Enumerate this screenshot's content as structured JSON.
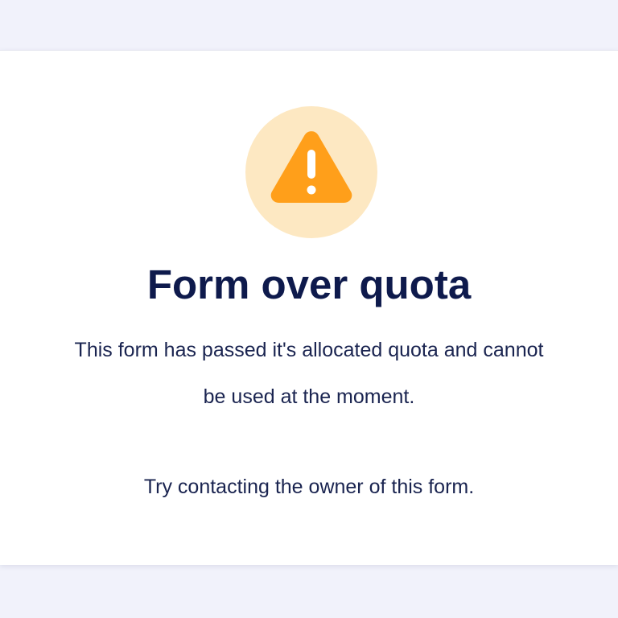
{
  "error": {
    "icon": "warning-triangle-icon",
    "icon_color": "#ff9f1a",
    "icon_background": "#fde8c2",
    "title": "Form over quota",
    "message": "This form has passed it's allocated quota and cannot be used at the moment.",
    "hint": "Try contacting the owner of this form."
  },
  "colors": {
    "page_background": "#f1f2fb",
    "card_background": "#ffffff",
    "title_color": "#0e1a4c",
    "text_color": "#1a2450"
  }
}
